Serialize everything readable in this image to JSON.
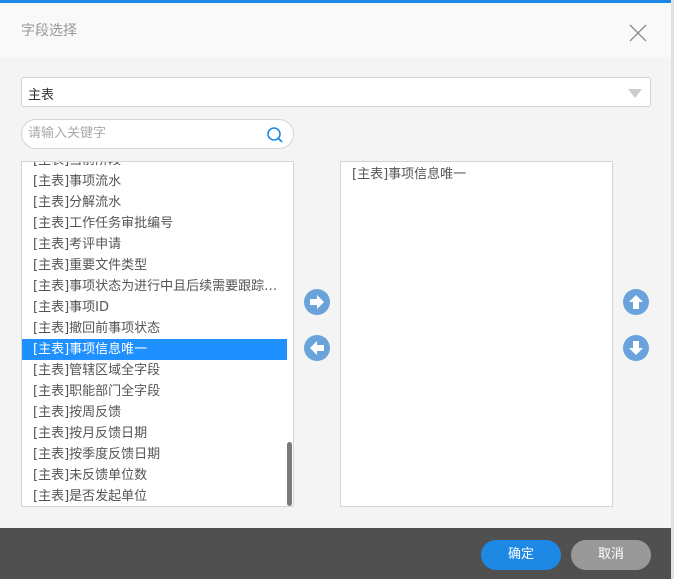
{
  "dialog": {
    "title": "字段选择"
  },
  "table_select": {
    "value": "主表"
  },
  "search": {
    "placeholder": "请输入关键字",
    "value": ""
  },
  "available_fields": [
    "[主表]当前阶段",
    "[主表]事项流水",
    "[主表]分解流水",
    "[主表]工作任务审批编号",
    "[主表]考评申请",
    "[主表]重要文件类型",
    "[主表]事项状态为进行中且后续需要跟踪的事项",
    "[主表]事项ID",
    "[主表]撤回前事项状态",
    "[主表]事项信息唯一",
    "[主表]管辖区域全字段",
    "[主表]职能部门全字段",
    "[主表]按周反馈",
    "[主表]按月反馈日期",
    "[主表]按季度反馈日期",
    "[主表]未反馈单位数",
    "[主表]是否发起单位"
  ],
  "selected_index": 9,
  "selected_fields": [
    "[主表]事项信息唯一"
  ],
  "footer": {
    "ok": "确定",
    "cancel": "取消"
  },
  "colors": {
    "accent": "#1e88e5",
    "selection": "#1e90ff",
    "arrow_buttons": "#6aa3dc"
  }
}
